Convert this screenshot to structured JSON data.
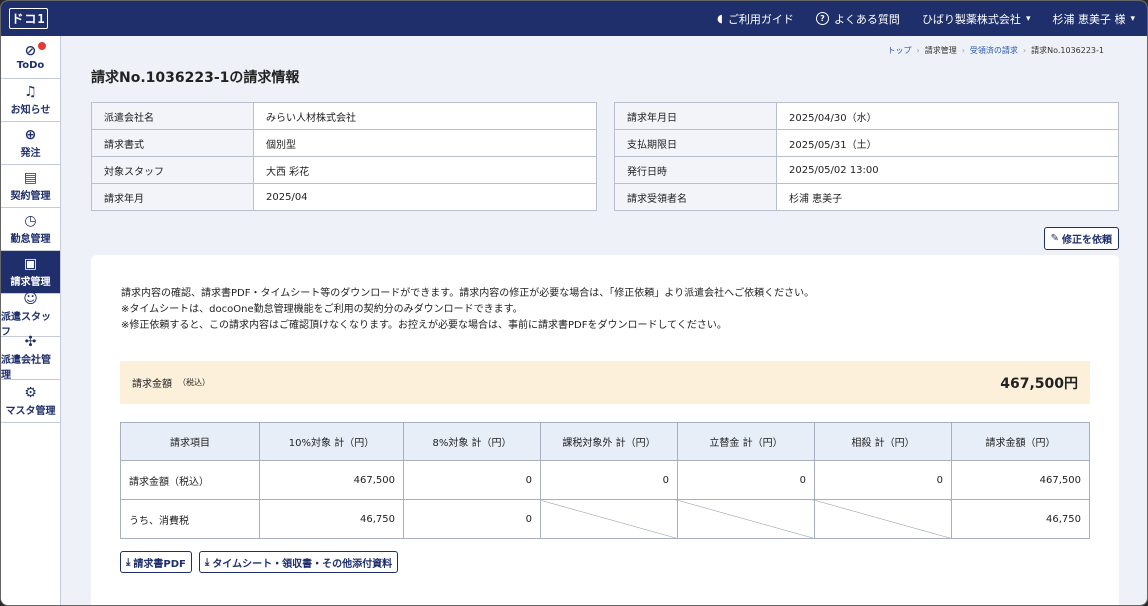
{
  "header": {
    "logo": "ドコ1",
    "guide": "ご利用ガイド",
    "faq": "よくある質問",
    "company": "ひばり製薬株式会社",
    "user": "杉浦 恵美子 様"
  },
  "sidebar": {
    "items": [
      {
        "label": "ToDo",
        "icon": "check-circle-icon"
      },
      {
        "label": "お知らせ",
        "icon": "bell-icon"
      },
      {
        "label": "発注",
        "icon": "search-person-icon"
      },
      {
        "label": "契約管理",
        "icon": "document-icon"
      },
      {
        "label": "勤怠管理",
        "icon": "clock-icon"
      },
      {
        "label": "請求管理",
        "icon": "invoice-icon"
      },
      {
        "label": "派遣スタッフ",
        "icon": "people-icon"
      },
      {
        "label": "派遣会社管理",
        "icon": "handshake-icon"
      },
      {
        "label": "マスタ管理",
        "icon": "gear-icon"
      }
    ],
    "active_index": 5
  },
  "breadcrumb": {
    "top": "トップ",
    "billing": "請求管理",
    "received": "受領済の請求",
    "current": "請求No.1036223-1"
  },
  "page_title": "請求No.1036223-1の請求情報",
  "info_left": [
    {
      "key": "派遣会社名",
      "value": "みらい人材株式会社"
    },
    {
      "key": "請求書式",
      "value": "個別型"
    },
    {
      "key": "対象スタッフ",
      "value": "大西 彩花"
    },
    {
      "key": "請求年月",
      "value": "2025/04"
    }
  ],
  "info_right": [
    {
      "key": "請求年月日",
      "value": "2025/04/30（水）"
    },
    {
      "key": "支払期限日",
      "value": "2025/05/31（土）"
    },
    {
      "key": "発行日時",
      "value": "2025/05/02 13:00"
    },
    {
      "key": "請求受領者名",
      "value": "杉浦 恵美子"
    }
  ],
  "fix_button": "修正を依頼",
  "notes": [
    "請求内容の確認、請求書PDF・タイムシート等のダウンロードができます。請求内容の修正が必要な場合は、「修正依頼」より派遣会社へご依頼ください。",
    "※タイムシートは、docoOne勤怠管理機能をご利用の契約分のみダウンロードできます。",
    "※修正依頼すると、この請求内容はご確認頂けなくなります。お控えが必要な場合は、事前に請求書PDFをダウンロードしてください。"
  ],
  "amount": {
    "label": "請求金額",
    "tax_note": "（税込）",
    "value": "467,500円"
  },
  "bill_table": {
    "headers": [
      "請求項目",
      "10%対象 計（円）",
      "8%対象 計（円）",
      "課税対象外 計（円）",
      "立替金 計（円）",
      "相殺 計（円）",
      "請求金額（円）"
    ],
    "row1": [
      "請求金額（税込）",
      "467,500",
      "0",
      "0",
      "0",
      "0",
      "467,500"
    ],
    "row2": [
      "うち、消費税",
      "46,750",
      "0",
      "",
      "",
      "",
      "46,750"
    ]
  },
  "buttons": {
    "pdf": "請求書PDF",
    "attachments": "タイムシート・領収書・その他添付資料"
  }
}
